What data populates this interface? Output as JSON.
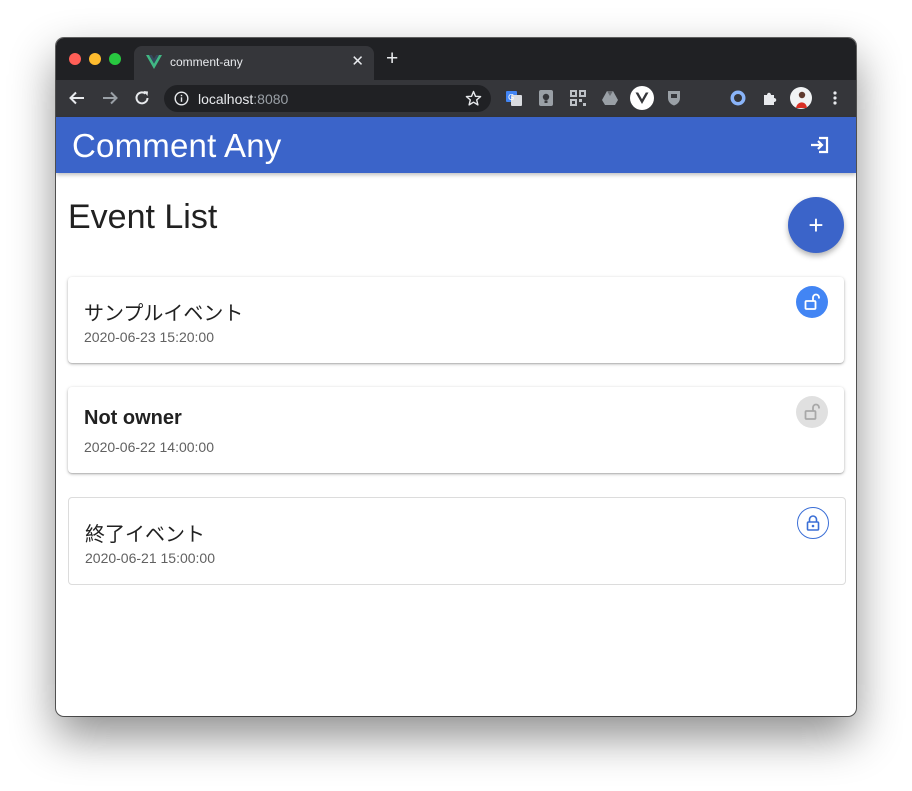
{
  "browser": {
    "tab_title": "comment-any",
    "new_tab": "+",
    "close": "✕",
    "url_host": "localhost",
    "url_port": ":8080"
  },
  "app": {
    "title": "Comment Any",
    "page_title": "Event List",
    "add_label": "+",
    "accent_color": "#3b64c9"
  },
  "events": [
    {
      "title": "サンプルイベント",
      "date": "2020-06-23 15:20:00",
      "lock_state": "unlocked-owner"
    },
    {
      "title": "Not owner",
      "date": "2020-06-22 14:00:00",
      "lock_state": "unlocked-disabled"
    },
    {
      "title": "終了イベント",
      "date": "2020-06-21 15:00:00",
      "lock_state": "locked"
    }
  ]
}
